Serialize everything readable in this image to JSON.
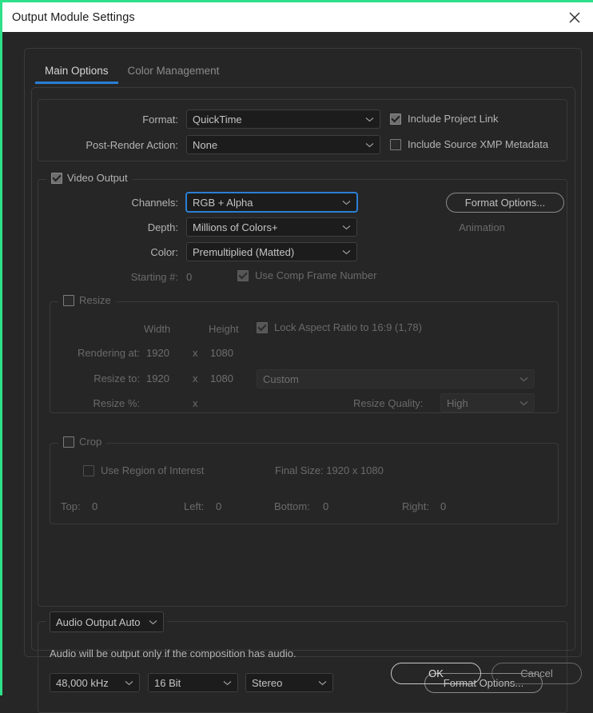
{
  "window": {
    "title": "Output Module Settings",
    "close_icon": "close-icon",
    "accent_green": "#2ee08a",
    "accent_blue": "#2a7fd4"
  },
  "tabs": [
    {
      "label": "Main Options",
      "active": true
    },
    {
      "label": "Color Management",
      "active": false
    }
  ],
  "format_section": {
    "format_label": "Format:",
    "format_value": "QuickTime",
    "post_render_label": "Post-Render Action:",
    "post_render_value": "None",
    "include_project_link": {
      "label": "Include Project Link",
      "checked": true
    },
    "include_xmp": {
      "label": "Include Source XMP Metadata",
      "checked": false
    }
  },
  "video_output": {
    "legend": "Video Output",
    "legend_checked": true,
    "channels_label": "Channels:",
    "channels_value": "RGB + Alpha",
    "depth_label": "Depth:",
    "depth_value": "Millions of Colors+",
    "color_label": "Color:",
    "color_value": "Premultiplied (Matted)",
    "starting_label": "Starting #:",
    "starting_value": "0",
    "use_comp_frame": {
      "label": "Use Comp Frame Number",
      "checked": true
    },
    "format_options_label": "Format Options...",
    "codec_name": "Animation"
  },
  "resize": {
    "legend": "Resize",
    "legend_checked": false,
    "width_header": "Width",
    "height_header": "Height",
    "lock_aspect": {
      "label": "Lock Aspect Ratio to 16:9 (1,78)",
      "checked": true
    },
    "rendering_at_label": "Rendering at:",
    "rendering_width": "1920",
    "rendering_x": "x",
    "rendering_height": "1080",
    "resize_to_label": "Resize to:",
    "resize_width": "1920",
    "resize_x": "x",
    "resize_height": "1080",
    "preset_value": "Custom",
    "resize_pct_label": "Resize %:",
    "resize_pct_x": "x",
    "quality_label": "Resize Quality:",
    "quality_value": "High"
  },
  "crop": {
    "legend": "Crop",
    "legend_checked": false,
    "use_roi": {
      "label": "Use Region of Interest",
      "checked": false
    },
    "final_size": "Final Size: 1920 x 1080",
    "top_label": "Top:",
    "top_value": "0",
    "left_label": "Left:",
    "left_value": "0",
    "bottom_label": "Bottom:",
    "bottom_value": "0",
    "right_label": "Right:",
    "right_value": "0"
  },
  "audio": {
    "output_mode": "Audio Output Auto",
    "note": "Audio will be output only if the composition has audio.",
    "sample_rate": "48,000 kHz",
    "bit_depth": "16 Bit",
    "channels": "Stereo",
    "format_options_label": "Format Options..."
  },
  "footer": {
    "ok_label": "OK",
    "cancel_label": "Cancel"
  }
}
